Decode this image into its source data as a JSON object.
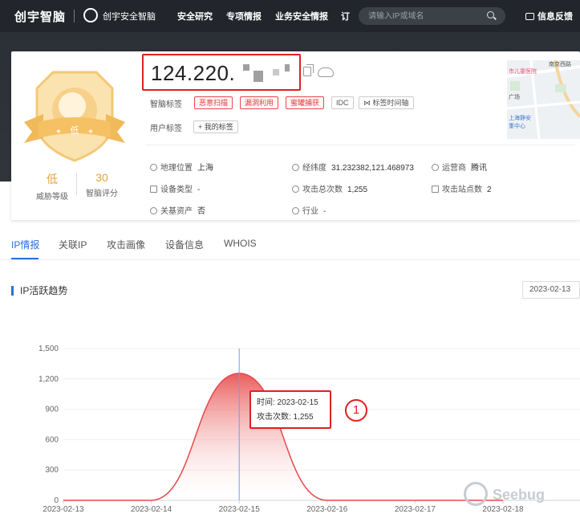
{
  "topbar": {
    "brand": "创宇智脑",
    "sub_brand": "创宇安全智脑",
    "nav": [
      "安全研究",
      "专项情报",
      "业务安全情报",
      "订"
    ],
    "search_placeholder": "请输入IP或域名",
    "feedback": "信息反馈"
  },
  "profile": {
    "badge_level_text": "低",
    "threat_level": {
      "value": "低",
      "label": "威胁等级"
    },
    "score": {
      "value": "30",
      "label": "智脑评分"
    },
    "ip": "124.220.",
    "brain_tags_label": "智脑标签",
    "brain_tags": [
      "恶意扫描",
      "漏洞利用",
      "蜜罐捕获",
      "IDC",
      "标签时间轴"
    ],
    "user_tags_label": "用户标签",
    "my_tag_button": "+ 我的标签",
    "info": {
      "location": {
        "label": "地理位置",
        "value": "上海"
      },
      "coords": {
        "label": "经纬度",
        "value": "31.232382,121.468973"
      },
      "isp": {
        "label": "运营商",
        "value": "腾讯"
      },
      "device_type": {
        "label": "设备类型",
        "value": "-"
      },
      "attack_total": {
        "label": "攻击总次数",
        "value": "1,255"
      },
      "attack_sites": {
        "label": "攻击站点数",
        "value": "2"
      },
      "related_assets": {
        "label": "关基资产",
        "value": "否"
      },
      "industry": {
        "label": "行业",
        "value": "-"
      }
    },
    "map_labels": [
      "南京西路",
      "市儿童医院",
      "广场",
      "上海静安",
      "重中心"
    ]
  },
  "tabs": [
    "IP情报",
    "关联IP",
    "攻击画像",
    "设备信息",
    "WHOIS"
  ],
  "section": {
    "title": "IP活跃趋势",
    "date_picker": "2023-02-13"
  },
  "chart_data": {
    "type": "area",
    "x": [
      "2023-02-13",
      "2023-02-14",
      "2023-02-15",
      "2023-02-16",
      "2023-02-17",
      "2023-02-18"
    ],
    "values": [
      0,
      0,
      1255,
      0,
      0,
      0
    ],
    "yticks": [
      "0",
      "300",
      "600",
      "900",
      "1,200",
      "1,500"
    ],
    "ylim": [
      0,
      1500
    ],
    "colors": {
      "line": "#e8464a",
      "fill_top": "#e84a4a",
      "fill_bottom": "#ffffff",
      "crosshair": "#7b9be0"
    },
    "tooltip": {
      "time_label": "时间: 2023-02-15",
      "count_label": "攻击次数: 1,255"
    }
  },
  "annotation": {
    "step": "1"
  },
  "watermark": "Seebug"
}
